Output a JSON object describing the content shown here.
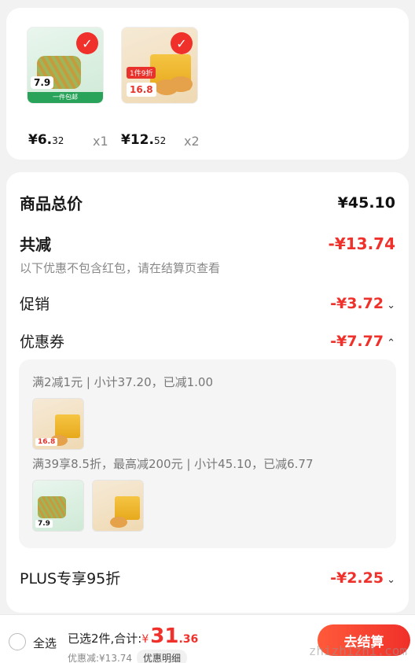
{
  "products": [
    {
      "price_main": "¥6.",
      "price_dec": "32",
      "qty": "x1",
      "tag_price": "7.9",
      "tag_banner": "一件包邮"
    },
    {
      "price_main": "¥12.",
      "price_dec": "52",
      "qty": "x2",
      "tag_red": "1件9折",
      "tag_price": "16.8"
    }
  ],
  "summary": {
    "total_label": "商品总价",
    "total_value": "¥45.10",
    "discount_label": "共减",
    "discount_value": "-¥13.74",
    "note": "以下优惠不包含红包，请在结算页查看",
    "promo_label": "促销",
    "promo_value": "-¥3.72",
    "coupon_label": "优惠券",
    "coupon_value": "-¥7.77",
    "coupon_line1": "满2减1元 | 小计37.20，已减1.00",
    "coupon_line2": "满39享8.5折，最高减200元 | 小计45.10，已减6.77",
    "plus_label": "PLUS专享95折",
    "plus_value": "-¥2.25",
    "mini_tag_a": "7.9",
    "mini_tag_b": "16.8"
  },
  "bottom": {
    "select_all": "全选",
    "selected_text": "已选2件,合计:",
    "sum_symbol": "¥",
    "sum_int": "31",
    "sum_dec": ".36",
    "discount_text": "优惠减:¥13.74",
    "detail_btn": "优惠明细",
    "checkout_btn": "去结算"
  },
  "watermark": "zhizhizhi.com"
}
